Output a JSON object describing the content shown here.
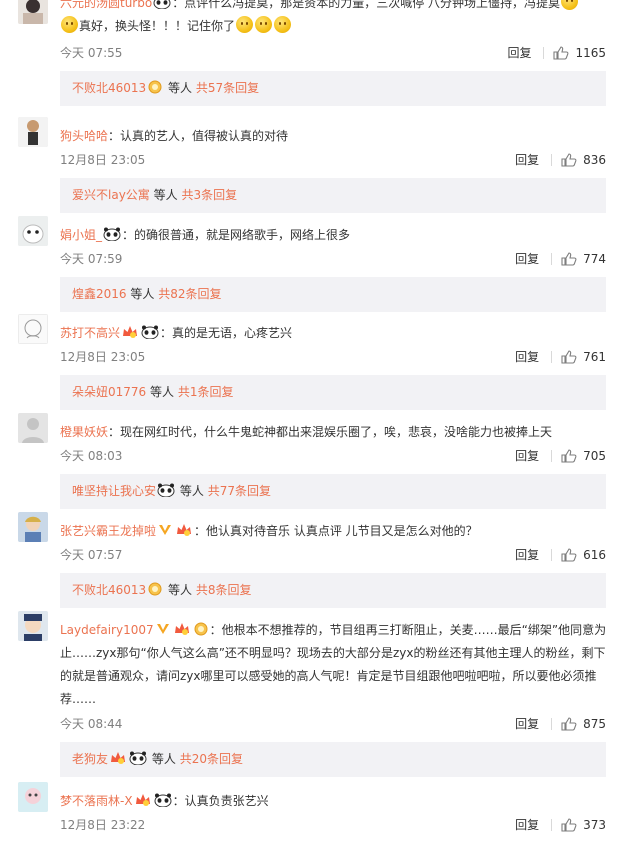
{
  "comments": [
    {
      "username": "六元的汤圆turbo",
      "segments": [
        "：点评什么冯提莫，那是资本的力量，三次喊停 八分钟场上僵持，冯提莫",
        "真好，换头怪！！！记住你了"
      ],
      "time": "今天 07:55",
      "reply_label": "回复",
      "likes": "1165",
      "reply_box": {
        "user": "不败北46013",
        "etc": "等人",
        "count": "共57条回复"
      }
    },
    {
      "username": "狗头哈哈",
      "segments": [
        "：认真的艺人，值得被认真的对待"
      ],
      "time": "12月8日 23:05",
      "reply_label": "回复",
      "likes": "836",
      "reply_box": {
        "user": "爱兴不lay公寓",
        "etc": "等人",
        "count": "共3条回复"
      }
    },
    {
      "username": "娟小姐_",
      "segments": [
        "：的确很普通，就是网络歌手，网络上很多"
      ],
      "time": "今天 07:59",
      "reply_label": "回复",
      "likes": "774",
      "reply_box": {
        "user": "煌鑫2016",
        "etc": "等人",
        "count": "共82条回复"
      }
    },
    {
      "username": "苏打不高兴",
      "segments": [
        "：真的是无语，心疼艺兴"
      ],
      "time": "12月8日 23:05",
      "reply_label": "回复",
      "likes": "761",
      "reply_box": {
        "user": "朵朵妞01776",
        "etc": "等人",
        "count": "共1条回复"
      }
    },
    {
      "username": "橙果妖妖",
      "segments": [
        "：现在网红时代，什么牛鬼蛇神都出来混娱乐圈了，唉，悲哀，没啥能力也被捧上天"
      ],
      "time": "今天 08:03",
      "reply_label": "回复",
      "likes": "705",
      "reply_box": {
        "user": "唯坚持让我心安",
        "etc": "等人",
        "count": "共77条回复"
      }
    },
    {
      "username": "张艺兴霸王龙掉啦",
      "segments": [
        "：他认真对待音乐 认真点评 儿节目又是怎么对他的？"
      ],
      "time": "今天 07:57",
      "reply_label": "回复",
      "likes": "616",
      "reply_box": {
        "user": "不败北46013",
        "etc": "等人",
        "count": "共8条回复"
      }
    },
    {
      "username": "Laydefairy1007",
      "segments": [
        "：他根本不想推荐的，节目组再三打断阻止，关麦……最后“绑架”他同意为止……zyx那句“你人气这么高”还不明显吗？现场去的大部分是zyx的粉丝还有其他主理人的粉丝，剩下的就是普通观众，请问zyx哪里可以感受她的高人气呢！肯定是节目组跟他吧啦吧啦，所以要他必须推荐……"
      ],
      "time": "今天 08:44",
      "reply_label": "回复",
      "likes": "875",
      "reply_box": {
        "user": "老狗友",
        "etc": "等人",
        "count": "共20条回复"
      }
    },
    {
      "username": "梦不落雨林-X",
      "segments": [
        "：认真负责张艺兴"
      ],
      "time": "12月8日 23:22",
      "reply_label": "回复",
      "likes": "373"
    }
  ]
}
